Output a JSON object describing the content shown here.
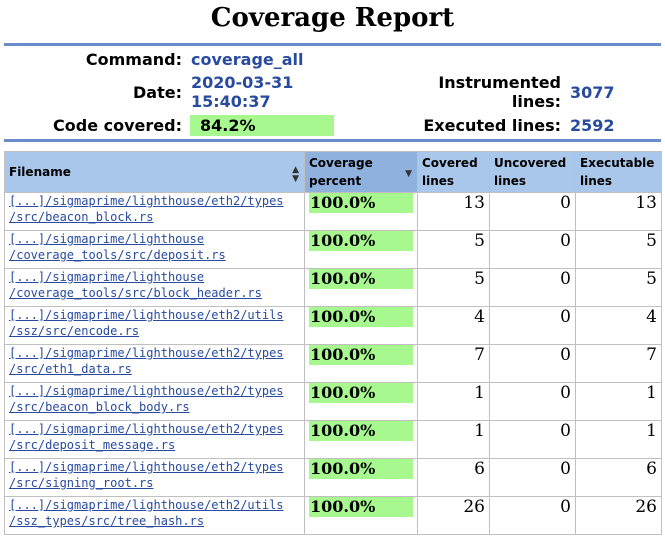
{
  "title": "Coverage Report",
  "summary": {
    "command_label": "Command:",
    "command": "coverage_all",
    "date_label": "Date:",
    "date_line1": "2020-03-31",
    "date_line2": "15:40:37",
    "code_covered_label": "Code covered:",
    "code_covered": "84.2%",
    "instrumented_label_line1": "Instrumented",
    "instrumented_label_line2": "lines:",
    "instrumented": "3077",
    "executed_label": "Executed lines:",
    "executed": "2592"
  },
  "colors": {
    "accent": "#284ba0",
    "bar": "#a8f890",
    "header": "#a9c7ea",
    "rule": "#6a8ccc"
  },
  "table": {
    "headers": [
      {
        "line1": "Filename",
        "line2": ""
      },
      {
        "line1": "Coverage",
        "line2": "percent"
      },
      {
        "line1": "Covered",
        "line2": "lines"
      },
      {
        "line1": "Uncovered",
        "line2": "lines"
      },
      {
        "line1": "Executable",
        "line2": "lines"
      }
    ],
    "sort_icons": [
      "sort-both-icon",
      "sort-desc-icon",
      "sort-both-icon",
      "sort-both-icon",
      "sort-both-icon"
    ],
    "rows": [
      {
        "path1": "[...]/sigmaprime/lighthouse/eth2/types",
        "path2": "/src/beacon_block.rs",
        "percent": "100.0%",
        "covered": "13",
        "uncovered": "0",
        "executable": "13"
      },
      {
        "path1": "[...]/sigmaprime/lighthouse",
        "path2": "/coverage_tools/src/deposit.rs",
        "percent": "100.0%",
        "covered": "5",
        "uncovered": "0",
        "executable": "5"
      },
      {
        "path1": "[...]/sigmaprime/lighthouse",
        "path2": "/coverage_tools/src/block_header.rs",
        "percent": "100.0%",
        "covered": "5",
        "uncovered": "0",
        "executable": "5"
      },
      {
        "path1": "[...]/sigmaprime/lighthouse/eth2/utils",
        "path2": "/ssz/src/encode.rs",
        "percent": "100.0%",
        "covered": "4",
        "uncovered": "0",
        "executable": "4"
      },
      {
        "path1": "[...]/sigmaprime/lighthouse/eth2/types",
        "path2": "/src/eth1_data.rs",
        "percent": "100.0%",
        "covered": "7",
        "uncovered": "0",
        "executable": "7"
      },
      {
        "path1": "[...]/sigmaprime/lighthouse/eth2/types",
        "path2": "/src/beacon_block_body.rs",
        "percent": "100.0%",
        "covered": "1",
        "uncovered": "0",
        "executable": "1"
      },
      {
        "path1": "[...]/sigmaprime/lighthouse/eth2/types",
        "path2": "/src/deposit_message.rs",
        "percent": "100.0%",
        "covered": "1",
        "uncovered": "0",
        "executable": "1"
      },
      {
        "path1": "[...]/sigmaprime/lighthouse/eth2/types",
        "path2": "/src/signing_root.rs",
        "percent": "100.0%",
        "covered": "6",
        "uncovered": "0",
        "executable": "6"
      },
      {
        "path1": "[...]/sigmaprime/lighthouse/eth2/utils",
        "path2": "/ssz_types/src/tree_hash.rs",
        "percent": "100.0%",
        "covered": "26",
        "uncovered": "0",
        "executable": "26"
      }
    ]
  }
}
